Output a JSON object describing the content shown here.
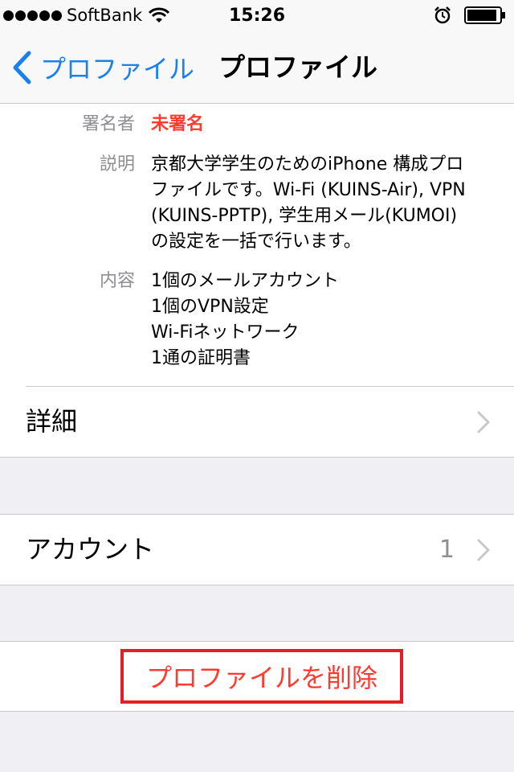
{
  "status_bar": {
    "carrier": "SoftBank",
    "time": "15:26",
    "icons": [
      "signal-dots",
      "wifi-icon",
      "alarm-icon",
      "battery-icon"
    ]
  },
  "nav": {
    "back_label": "プロファイル",
    "title": "プロファイル"
  },
  "profile_info": {
    "signer_label": "署名者",
    "signer_value": "未署名",
    "description_label": "説明",
    "description_lines": [
      "京都大学学生のためのiPhone 構成プロ",
      "ファイルです。Wi-Fi (KUINS-Air), VPN",
      "(KUINS-PPTP), 学生用メール(KUMOI)",
      "の設定を一括で行います。"
    ],
    "contents_label": "内容",
    "contents_lines": [
      "1個のメールアカウント",
      "1個のVPN設定",
      "Wi-Fiネットワーク",
      "1通の証明書"
    ]
  },
  "details_row": {
    "label": "詳細"
  },
  "account_row": {
    "label": "アカウント",
    "count": "1"
  },
  "delete_button": {
    "label": "プロファイルを削除"
  },
  "colors": {
    "accent_blue": "#1a80f0",
    "destructive_red": "#ff3b30",
    "highlight_box": "#e21f26",
    "grouped_background": "#efeff4",
    "secondary_text": "#8e8e93"
  }
}
